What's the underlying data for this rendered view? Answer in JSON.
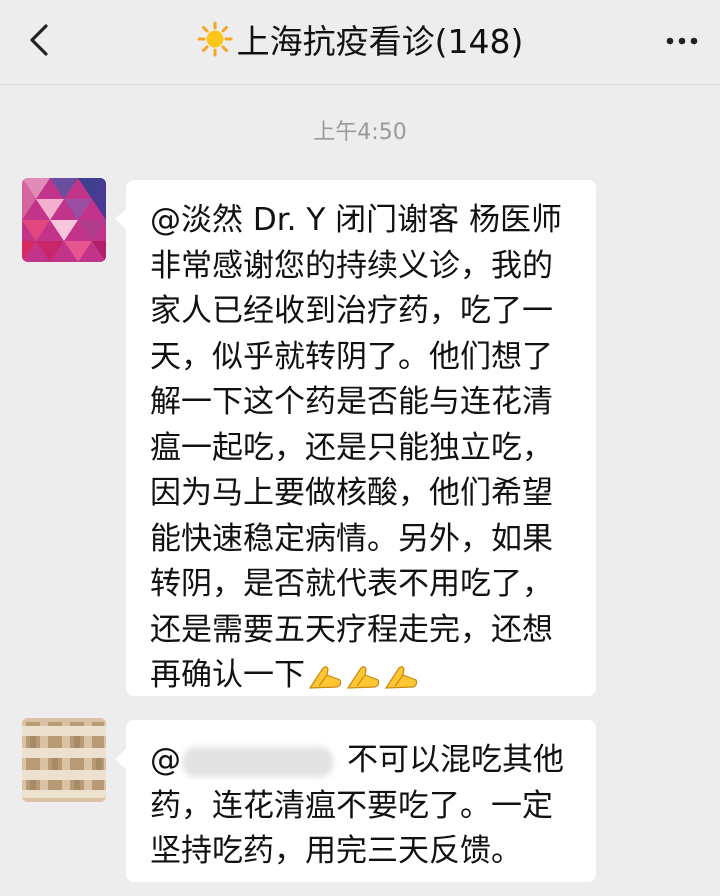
{
  "header": {
    "title": "上海抗疫看诊(148)",
    "sun_icon": "sun-emoji",
    "back_icon": "chevron-left-icon",
    "more_icon": "more-dots-icon"
  },
  "timestamp": "上午4:50",
  "messages": [
    {
      "avatar": "pink-triangle-avatar",
      "lines": [
        "@淡然 Dr. Y 闭门谢客  杨医师",
        "非常感谢您的持续义诊，我的",
        "家人已经收到治疗药，吃了一",
        "天，似乎就转阴了。他们想了",
        "解一下这个药是否能与连花清",
        "瘟一起吃，还是只能独立吃，",
        "因为马上要做核酸，他们希望",
        "能快速稳定病情。另外，如果",
        "转阴，是否就代表不用吃了，",
        "还是需要五天疗程走完，还想",
        "再确认一下"
      ],
      "trailing_emoji": "folded-hands-emoji ×3"
    },
    {
      "avatar": "woven-pattern-avatar",
      "mention_prefix": "@",
      "lines": [
        "不可以混吃其他",
        "药，连花清瘟不要吃了。一定",
        "坚持吃药，用完三天反馈。"
      ]
    }
  ],
  "colors": {
    "background": "#ededed",
    "bubble": "#ffffff",
    "text": "#111111",
    "timestamp": "#9a9a9a"
  }
}
